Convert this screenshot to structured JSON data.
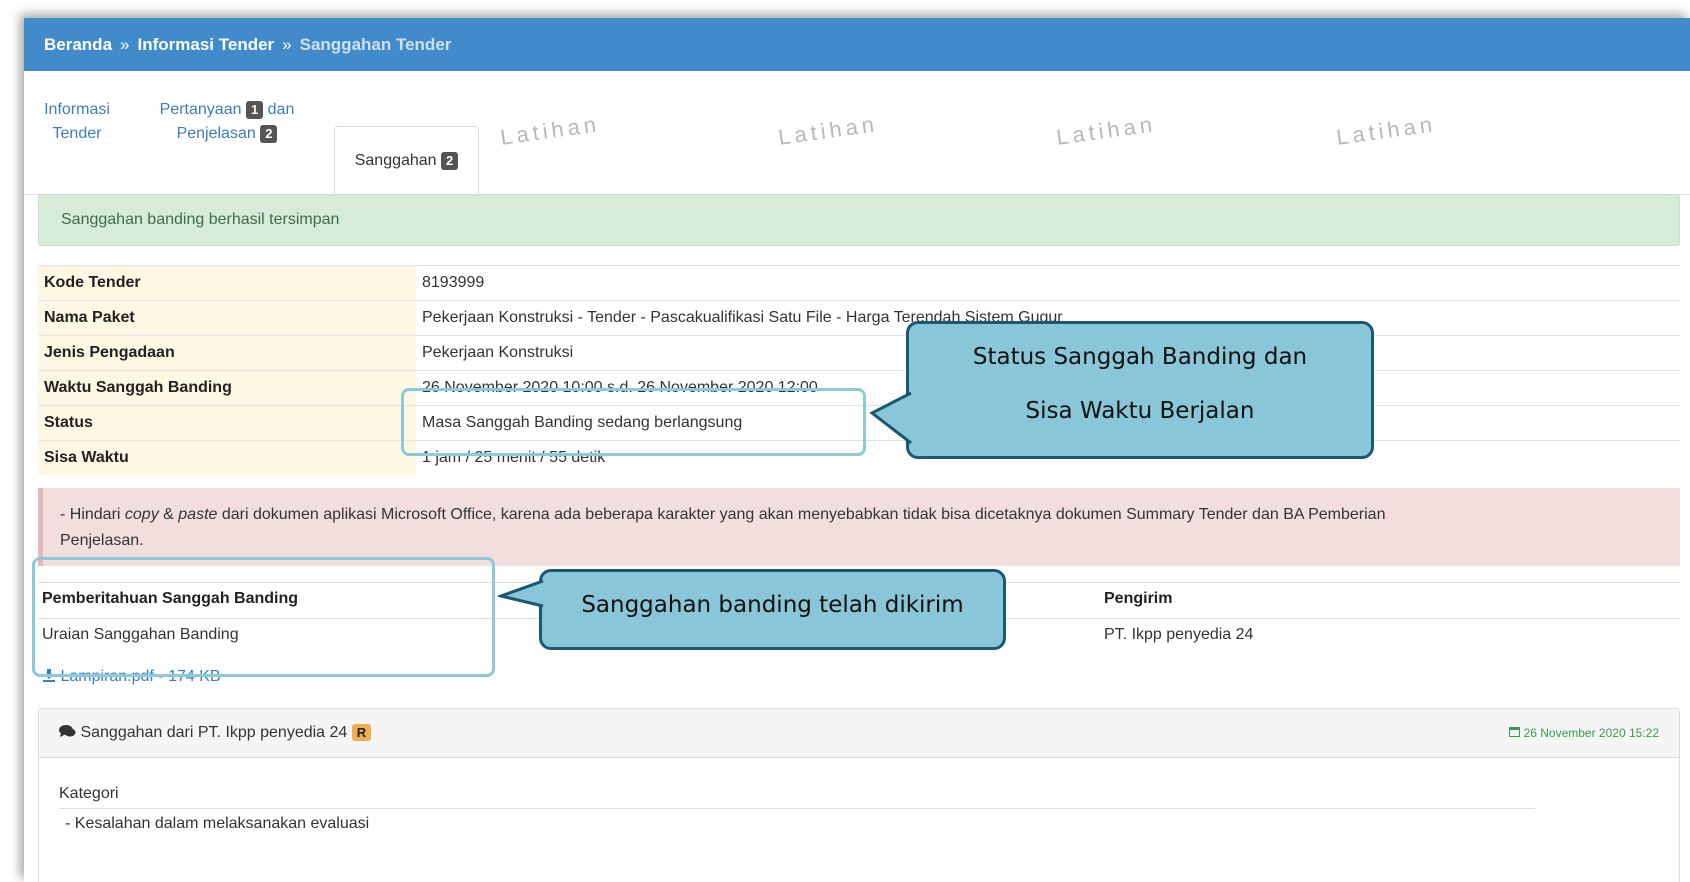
{
  "breadcrumb": {
    "home": "Beranda",
    "separator": "»",
    "info": "Informasi Tender",
    "current": "Sanggahan Tender"
  },
  "watermark": "Latihan",
  "tabs": {
    "info_line1": "Informasi",
    "info_line2": "Tender",
    "pertanyaan_line1": "Pertanyaan",
    "pertanyaan_count": "1",
    "pertanyaan_dan": "dan",
    "penjelasan": "Penjelasan",
    "penjelasan_count": "2",
    "sanggahan": "Sanggahan",
    "sanggahan_count": "2"
  },
  "success_message": "Sanggahan banding berhasil tersimpan",
  "info_table": [
    {
      "key": "Kode Tender",
      "value": "8193999"
    },
    {
      "key": "Nama Paket",
      "value": "Pekerjaan Konstruksi - Tender - Pascakualifikasi Satu File - Harga Terendah Sistem Gugur"
    },
    {
      "key": "Jenis Pengadaan",
      "value": "Pekerjaan Konstruksi"
    },
    {
      "key": "Waktu Sanggah Banding",
      "value": "26 November 2020 10:00 s.d. 26 November 2020 12:00"
    },
    {
      "key": "Status",
      "value": "Masa Sanggah Banding sedang berlangsung"
    },
    {
      "key": "Sisa Waktu",
      "value": "1 jam / 25 menit / 55 detik"
    }
  ],
  "notice": {
    "part1": "- Hindari ",
    "copy": "copy",
    "amp": " & ",
    "paste": "paste",
    "part2": " dari dokumen aplikasi Microsoft Office, karena ada beberapa karakter yang akan menyebabkan tidak bisa dicetaknya dokumen Summary Tender dan BA Pemberian",
    "part3": "Penjelasan."
  },
  "pemberitahuan": {
    "header": "Pemberitahuan Sanggah Banding",
    "sender_header": "Pengirim",
    "uraian": "Uraian Sanggahan Banding",
    "sender": "PT. Ikpp penyedia 24",
    "attachment": "Lampiran.pdf - 174 KB"
  },
  "panel": {
    "title": "Sanggahan dari PT. Ikpp penyedia 24",
    "badge": "R",
    "date": "26 November 2020 15:22",
    "kategori_label": "Kategori",
    "kategori_item": "-  Kesalahan dalam melaksanakan evaluasi"
  },
  "callouts": {
    "status_line1": "Status Sanggah Banding dan",
    "status_line2": "Sisa Waktu Berjalan",
    "sent": "Sanggahan banding telah dikirim"
  },
  "colors": {
    "topbar": "#418bca",
    "callout_fill": "#89c6d7",
    "callout_border": "#1b5876",
    "highlight": "#8cc9da"
  }
}
